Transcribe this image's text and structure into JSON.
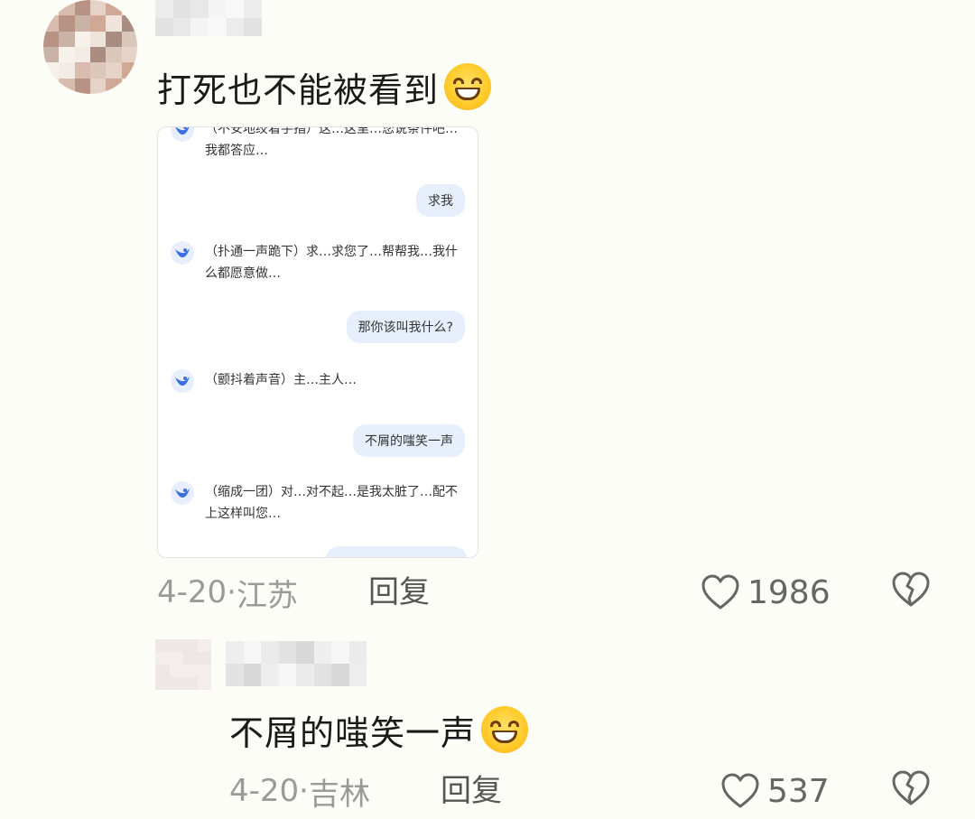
{
  "comment1": {
    "text": "打死也不能被看到",
    "date": "4-20",
    "location": "江苏",
    "reply_label": "回复",
    "likes": "1986"
  },
  "chat": {
    "top_partial": "（不安地绞着手指）这…这里…您说条件吧…我都答应…",
    "top_partial_visible": "吧…我都答应…",
    "messages": [
      {
        "role": "user",
        "text": "求我"
      },
      {
        "role": "ai",
        "text": "（扑通一声跪下）求…求您了…帮帮我…我什么都愿意做…"
      },
      {
        "role": "user",
        "text": "那你该叫我什么?"
      },
      {
        "role": "ai",
        "text": "（颤抖着声音）主…主人…"
      },
      {
        "role": "user",
        "text": "不屑的嗤笑一声"
      },
      {
        "role": "ai",
        "text": "（缩成一团）对…对不起…是我太脏了…配不上这样叫您…"
      }
    ]
  },
  "comment2": {
    "text": "不屑的嗤笑一声",
    "date": "4-20",
    "location": "吉林",
    "reply_label": "回复",
    "likes": "537"
  },
  "colors": {
    "background": "#fdfdf8",
    "user_bubble": "#e8effc",
    "ai_icon": "#3a6fe0"
  }
}
